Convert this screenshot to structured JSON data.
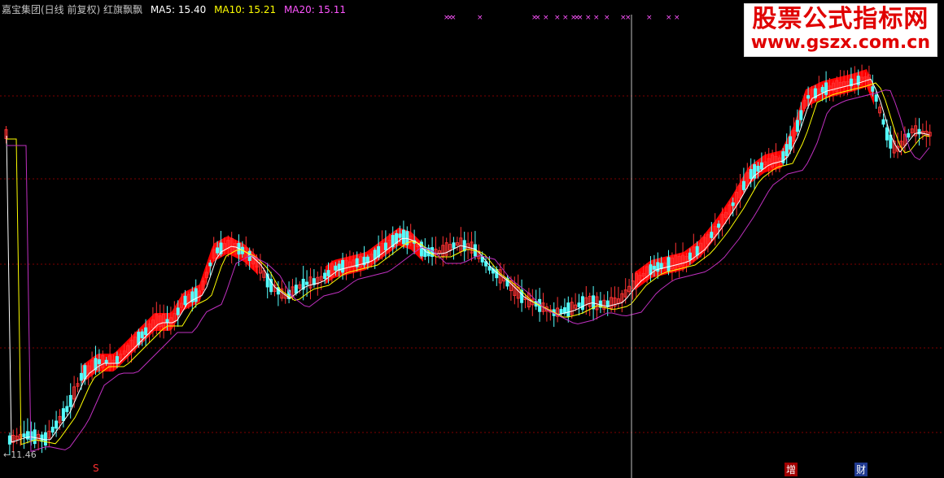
{
  "header": {
    "title": "嘉宝集团(日线 前复权) 红旗飘飘",
    "ma5_label": "MA5: 15.40",
    "ma10_label": "MA10: 15.21",
    "ma20_label": "MA20: 15.11",
    "ma5_color": "#ffffff",
    "ma10_color": "#ffff00",
    "ma20_color": "#ff55ff",
    "title_color": "#c0c0c0"
  },
  "watermark": {
    "line1": "股票公式指标网",
    "line2": "www.gszx.com.cn"
  },
  "markers": {
    "low_label": "←11.46",
    "bottom_event_left": "S",
    "event_zeng": "增",
    "event_cai": "财"
  },
  "colors": {
    "up": "#ff3232",
    "down": "#54ffff",
    "fill": "#ff0000",
    "grid": "#800000",
    "cursor": "#c0c0c0",
    "ma5": "#ffffff",
    "ma10": "#ffff00",
    "ma20": "#c030c0",
    "cross": "#ff55ff"
  },
  "chart_data": {
    "type": "candlestick",
    "title": "嘉宝集团(日线 前复权) 红旗飘飘",
    "series": [
      {
        "name": "MA5",
        "last": 15.4
      },
      {
        "name": "MA10",
        "last": 15.21
      },
      {
        "name": "MA20",
        "last": 15.11
      }
    ],
    "y_low": 11.46,
    "grid": true
  }
}
